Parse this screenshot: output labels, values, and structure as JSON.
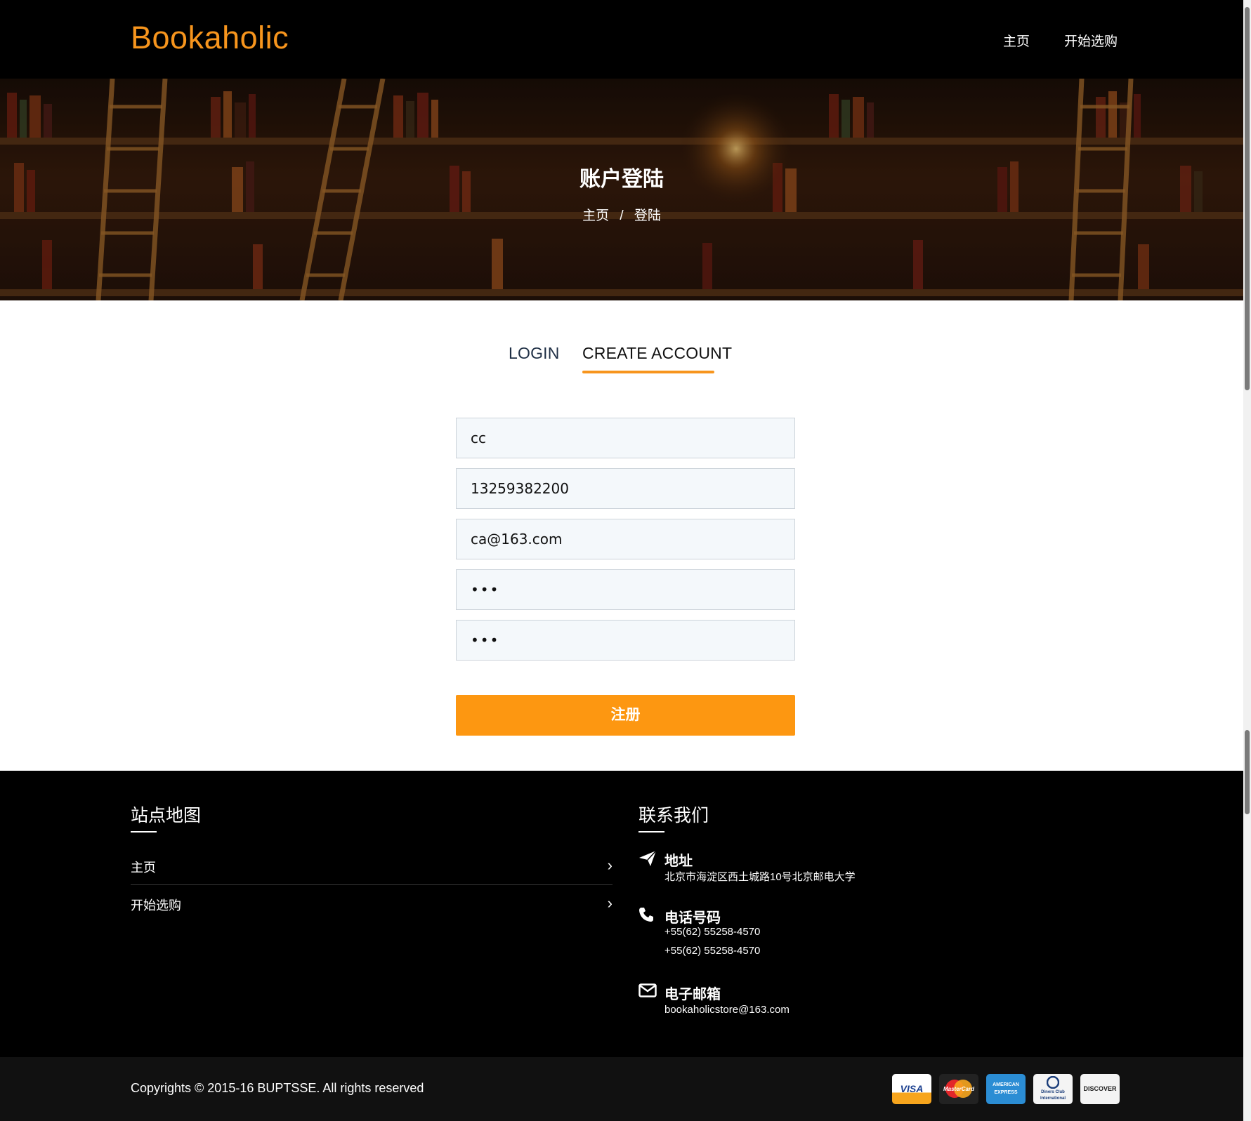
{
  "header": {
    "logo": "Bookaholic",
    "nav": [
      {
        "label": "主页"
      },
      {
        "label": "开始选购"
      }
    ]
  },
  "banner": {
    "title": "账户登陆",
    "breadcrumb": {
      "home": "主页",
      "separator": "/",
      "current": "登陆"
    }
  },
  "tabs": {
    "login": "LOGIN",
    "create": "CREATE ACCOUNT",
    "active": "create"
  },
  "form": {
    "username": "cc",
    "phone": "13259382200",
    "email": "ca@163.com",
    "password": "•••",
    "confirm_password": "•••",
    "submit_label": "注册"
  },
  "footer": {
    "sitemap": {
      "title": "站点地图",
      "items": [
        {
          "label": "主页"
        },
        {
          "label": "开始选购"
        }
      ]
    },
    "contact": {
      "title": "联系我们",
      "address_title": "地址",
      "address": "北京市海淀区西土城路10号北京邮电大学",
      "phone_title": "电话号码",
      "phones": [
        "+55(62) 55258-4570",
        "+55(62) 55258-4570"
      ],
      "email_title": "电子邮箱",
      "email": "bookaholicstore@163.com"
    },
    "copyright": "Copyrights © 2015-16 BUPTSSE. All rights reserved",
    "payment_cards": [
      {
        "name": "VISA",
        "icon": "visa-card-icon"
      },
      {
        "name": "MasterCard",
        "icon": "mastercard-icon"
      },
      {
        "name": "AMERICAN EXPRESS",
        "icon": "amex-card-icon"
      },
      {
        "name": "Diners Club International",
        "icon": "diners-club-icon"
      },
      {
        "name": "DISCOVER",
        "icon": "discover-card-icon"
      }
    ]
  },
  "colors": {
    "accent": "#f7951d",
    "button": "#fd9711",
    "background_dark": "#000000"
  }
}
